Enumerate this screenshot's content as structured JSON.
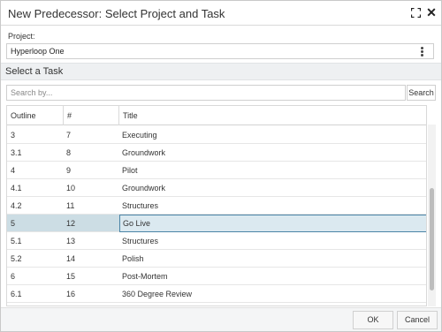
{
  "dialog": {
    "title": "New Predecessor: Select Project and Task",
    "expand_icon": "expand-icon",
    "close_icon": "close-icon",
    "close_glyph": "✕"
  },
  "project": {
    "label": "Project:",
    "value": "Hyperloop One",
    "menu_icon": "kebab-menu-icon"
  },
  "task_section": {
    "title": "Select a Task",
    "search_placeholder": "Search by...",
    "search_button": "Search"
  },
  "grid": {
    "columns": [
      "Outline",
      "#",
      "Title"
    ],
    "rows": [
      {
        "outline": "3",
        "num": "7",
        "title": "Executing"
      },
      {
        "outline": "3.1",
        "num": "8",
        "title": "Groundwork"
      },
      {
        "outline": "4",
        "num": "9",
        "title": "Pilot"
      },
      {
        "outline": "4.1",
        "num": "10",
        "title": "Groundwork"
      },
      {
        "outline": "4.2",
        "num": "11",
        "title": "Structures"
      },
      {
        "outline": "5",
        "num": "12",
        "title": "Go Live",
        "selected": true
      },
      {
        "outline": "5.1",
        "num": "13",
        "title": "Structures"
      },
      {
        "outline": "5.2",
        "num": "14",
        "title": "Polish"
      },
      {
        "outline": "6",
        "num": "15",
        "title": "Post-Mortem"
      },
      {
        "outline": "6.1",
        "num": "16",
        "title": "360 Degree Review"
      }
    ]
  },
  "footer": {
    "ok_label": "OK",
    "cancel_label": "Cancel"
  },
  "colors": {
    "selected_row": "#ccdde4",
    "selected_border": "#4b84a6"
  }
}
